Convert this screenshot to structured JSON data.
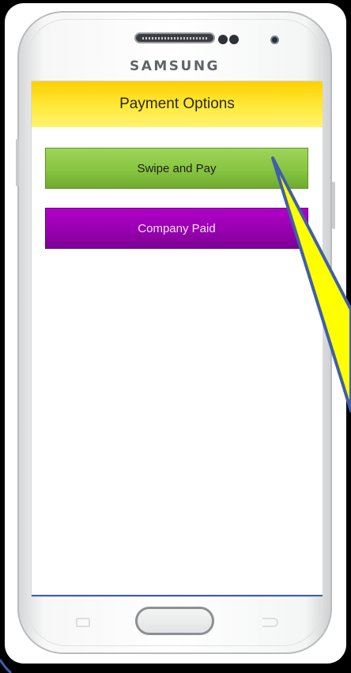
{
  "device": {
    "brand": "SAMSUNG"
  },
  "screen": {
    "title": "Payment Options",
    "buttons": [
      {
        "label": "Swipe and Pay",
        "color": "#88c540"
      },
      {
        "label": "Company Paid",
        "color": "#9800b0"
      }
    ]
  },
  "colors": {
    "header": "#ffe11a",
    "callout": "#ffff00",
    "callout_outline": "#3f5fa8"
  },
  "icons": [
    "menu-key-icon",
    "home-button",
    "back-key-icon"
  ]
}
